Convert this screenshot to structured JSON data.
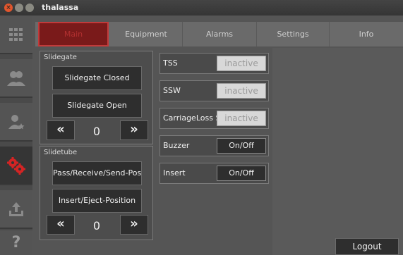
{
  "window": {
    "title": "thalassa",
    "close_glyph": "×"
  },
  "sidebar": {
    "items": [
      {
        "icon": "grid-icon"
      },
      {
        "icon": "users-icon"
      },
      {
        "icon": "user-star-icon"
      },
      {
        "icon": "gears-icon",
        "active": true
      },
      {
        "icon": "upload-icon"
      },
      {
        "icon": "help-icon",
        "glyph": "?"
      }
    ]
  },
  "tabs": [
    {
      "label": "Main",
      "active": true
    },
    {
      "label": "Equipment"
    },
    {
      "label": "Alarms"
    },
    {
      "label": "Settings"
    },
    {
      "label": "Info"
    }
  ],
  "slidegate": {
    "title": "Slidegate",
    "closed_label": "Slidegate Closed",
    "open_label": "Slidegate Open",
    "counter": "0",
    "left_arrow": "«",
    "right_arrow": "»"
  },
  "slidetube": {
    "title": "Slidetube",
    "pass_label": "Pass/Receive/Send-Position",
    "insert_label": "Insert/Eject-Position",
    "counter": "0",
    "left_arrow": "«",
    "right_arrow": "»"
  },
  "status_rows": [
    {
      "label": "TSS",
      "value": "inactive"
    },
    {
      "label": "SSW",
      "value": "inactive"
    },
    {
      "label": "CarriageLoss S",
      "value": "inactive"
    }
  ],
  "toggle_rows": [
    {
      "label": "Buzzer",
      "value": "On/Off"
    },
    {
      "label": "Insert",
      "value": "On/Off"
    }
  ],
  "logout_label": "Logout",
  "colors": {
    "accent": "#c23a3a",
    "background": "#555555"
  }
}
